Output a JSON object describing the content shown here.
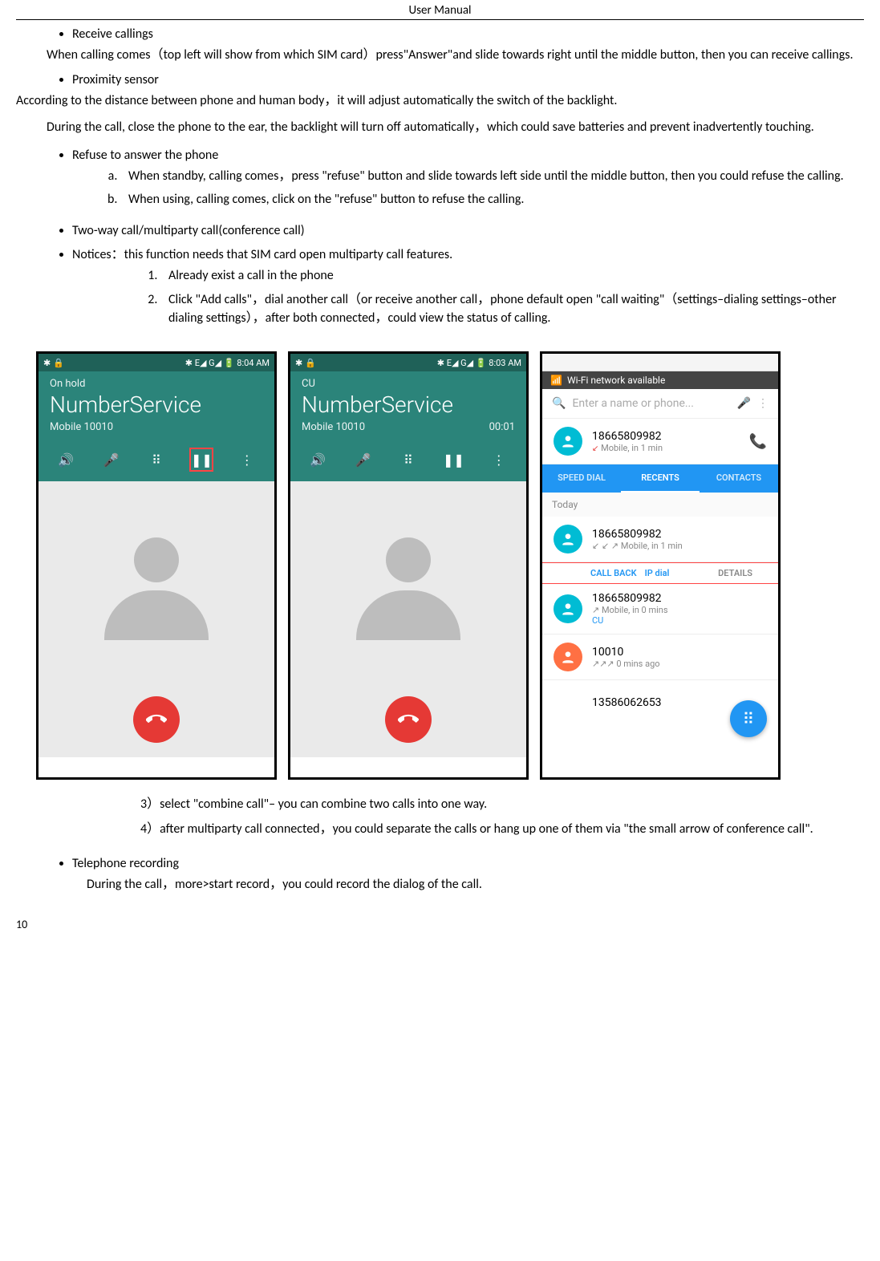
{
  "page": {
    "header": "User    Manual",
    "footer_page": "10"
  },
  "sections": {
    "receive": {
      "title": "Receive callings",
      "body": "When calling comes（top left will show from which SIM card）press\"Answer\"and slide towards right until the middle button, then you can receive callings."
    },
    "proximity": {
      "title": "Proximity sensor",
      "body1": "According to the distance between phone and human body，it will adjust automatically the switch of the backlight.",
      "body2": "During the call, close the phone to the ear, the backlight will turn off automatically，which could save batteries and prevent inadvertently touching."
    },
    "refuse": {
      "title": "Refuse to answer the phone",
      "a": "When standby, calling comes，press \"refuse\" button and slide towards left side until the middle button, then you could refuse the calling.",
      "b": "When using, calling comes, click on the \"refuse\" button to refuse the calling."
    },
    "twoway": {
      "title": "Two-way call/multiparty call(conference call)",
      "notices": "Notices：this function needs that SIM card open multiparty call features.",
      "step1": "Already exist a call in the phone",
      "step2": "Click \"Add calls\"，dial another call（or receive another call，phone default open \"call waiting\"（settings–dialing settings–other dialing settings），after both connected，could view the status of calling.",
      "step3": "3）select \"combine call\"– you can combine two calls into one way.",
      "step4": "4）after multiparty call connected，you could separate the calls or hang up one of them via \"the small arrow of conference call\"."
    },
    "recording": {
      "title": "Telephone recording",
      "body": "During the call，more>start record，you could record the dialog of the call."
    }
  },
  "phone1": {
    "status_left": "✱ 🔒",
    "status_right": "✱ E◢ G◢ 🔋 8:04 AM",
    "sub": "On hold",
    "title": "NumberService",
    "meta": "Mobile  10010",
    "icons": {
      "speaker": "🔊",
      "mute": "🎤",
      "dialpad": "⠿",
      "pause": "❚❚",
      "more": "⋮"
    }
  },
  "phone2": {
    "status_left": "✱ 🔒",
    "status_right": "✱ E◢ G◢ 🔋 8:03 AM",
    "sub": "CU",
    "title": "NumberService",
    "meta_left": "Mobile  10010",
    "meta_right": "00:01",
    "icons": {
      "speaker": "🔊",
      "mute": "🎤",
      "dialpad": "⠿",
      "pause": "❚❚",
      "more": "⋮"
    }
  },
  "phone3": {
    "banner_icon": "📶",
    "banner": "Wi-Fi network available",
    "search_icon": "🔍",
    "search_placeholder": "Enter a name or phone...",
    "mic_icon": "🎤",
    "more_icon": "⋮",
    "top_number": "18665809982",
    "top_meta_arrow": "↙",
    "top_meta": "Mobile, in 1 min",
    "phone_icon": "📞",
    "tabs": {
      "speeddial": "SPEED DIAL",
      "recents": "RECENTS",
      "contacts": "CONTACTS"
    },
    "section_today": "Today",
    "row1_number": "18665809982",
    "row1_meta": "↙ ↙ ↗  Mobile, in 1 min",
    "actions": {
      "callback": "CALL BACK",
      "ipdial": "IP dial",
      "details": "DETAILS"
    },
    "row2_number": "18665809982",
    "row2_meta": "↗  Mobile, in 0 mins",
    "row2_sub": "CU",
    "row3_number": "10010",
    "row3_meta": "↗↗↗  0 mins ago",
    "row4_number": "13586062653",
    "fab_icon": "⠿"
  }
}
